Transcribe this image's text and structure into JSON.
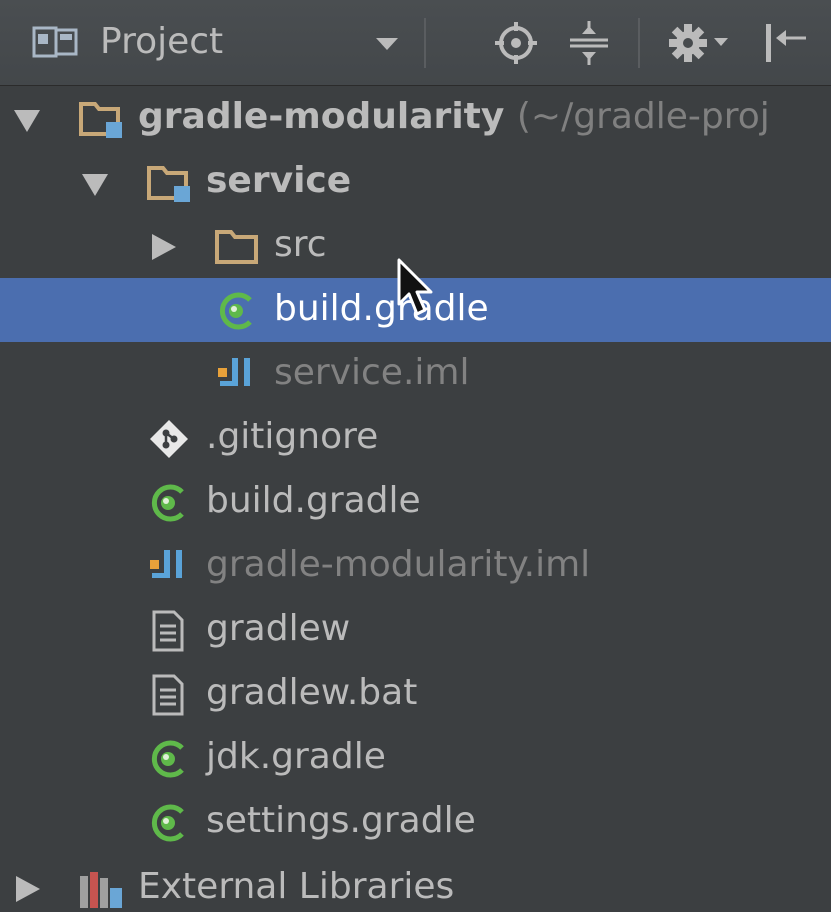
{
  "header": {
    "view_label": "Project",
    "tools": [
      "locate-icon",
      "collapse-all-icon",
      "gear-icon",
      "hide-icon"
    ]
  },
  "tree": {
    "root": {
      "name": "gradle-modularity",
      "path_hint": "(~/gradle-proj",
      "expanded": true
    },
    "service": {
      "name": "service",
      "expanded": true
    },
    "src": {
      "name": "src",
      "expanded": false
    },
    "service_build_gradle": {
      "name": "build.gradle",
      "selected": true
    },
    "service_iml": {
      "name": "service.iml"
    },
    "gitignore": {
      "name": ".gitignore"
    },
    "build_gradle": {
      "name": "build.gradle"
    },
    "module_iml": {
      "name": "gradle-modularity.iml"
    },
    "gradlew": {
      "name": "gradlew"
    },
    "gradlew_bat": {
      "name": "gradlew.bat"
    },
    "jdk_gradle": {
      "name": "jdk.gradle"
    },
    "settings_gradle": {
      "name": "settings.gradle"
    },
    "external_libraries": {
      "name": "External Libraries",
      "expanded": false
    }
  },
  "colors": {
    "background": "#3c3f41",
    "selection": "#4b6eaf",
    "folder": "#c8a878",
    "module_marker": "#6aa6d6",
    "gradle_green": "#5fb94a",
    "iml_orange": "#e8a13a",
    "iml_blue": "#5aa3d8"
  }
}
